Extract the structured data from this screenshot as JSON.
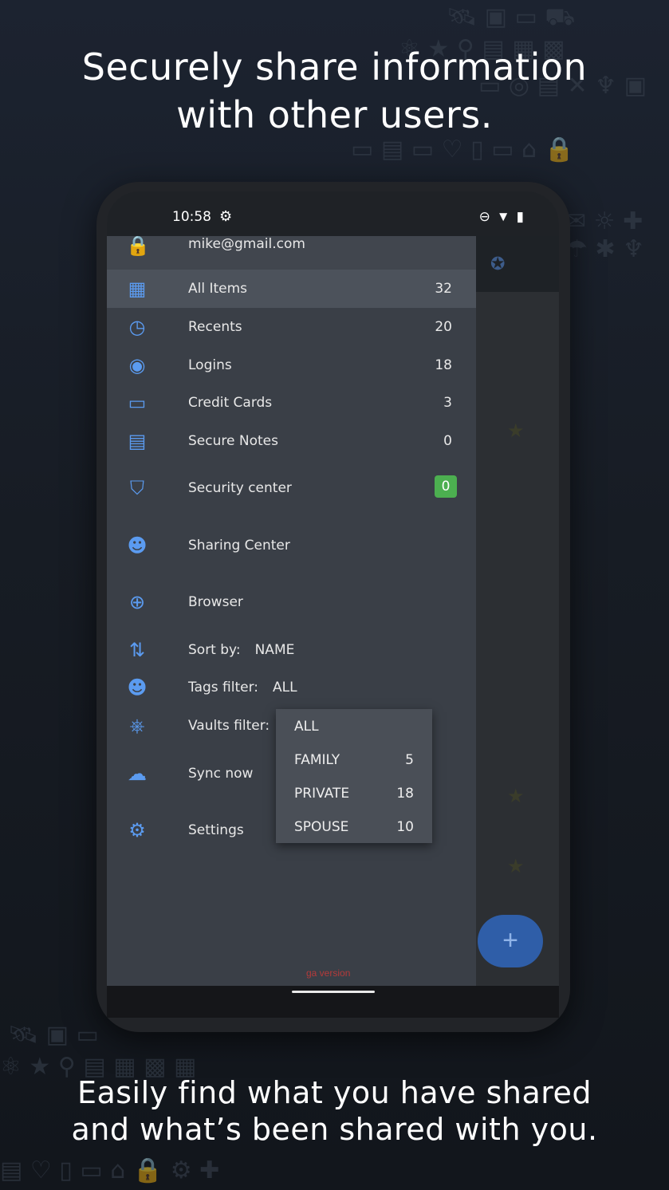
{
  "headline_top_line1": "Securely share information",
  "headline_top_line2": "with other users.",
  "headline_bottom_line1": "Easily find what you have shared",
  "headline_bottom_line2": "and what’s been shared with you.",
  "status": {
    "time": "10:58"
  },
  "drawer": {
    "account": "mike@gmail.com",
    "items": [
      {
        "label": "All Items",
        "count": "32",
        "icon": "grid-icon"
      },
      {
        "label": "Recents",
        "count": "20",
        "icon": "clock-icon"
      },
      {
        "label": "Logins",
        "count": "18",
        "icon": "globe-icon"
      },
      {
        "label": "Credit Cards",
        "count": "3",
        "icon": "credit-card-icon"
      },
      {
        "label": "Secure Notes",
        "count": "0",
        "icon": "note-icon"
      },
      {
        "label": "Security center",
        "count": "0",
        "icon": "shield-icon"
      },
      {
        "label": "Sharing Center",
        "icon": "people-icon"
      },
      {
        "label": "Browser",
        "icon": "globe-icon"
      }
    ],
    "sort_label": "Sort by:",
    "sort_value": "NAME",
    "tags_label": "Tags filter:",
    "tags_value": "ALL",
    "vaults_label": "Vaults filter:",
    "sync_label": "Sync now",
    "settings_label": "Settings"
  },
  "vault_menu": [
    {
      "label": "ALL",
      "count": ""
    },
    {
      "label": "FAMILY",
      "count": "5"
    },
    {
      "label": "PRIVATE",
      "count": "18"
    },
    {
      "label": "SPOUSE",
      "count": "10"
    }
  ],
  "version_text": "ga version",
  "colors": {
    "accent": "#5b9bf0",
    "badge": "#4caf50",
    "drawer": "#3a3f47"
  }
}
